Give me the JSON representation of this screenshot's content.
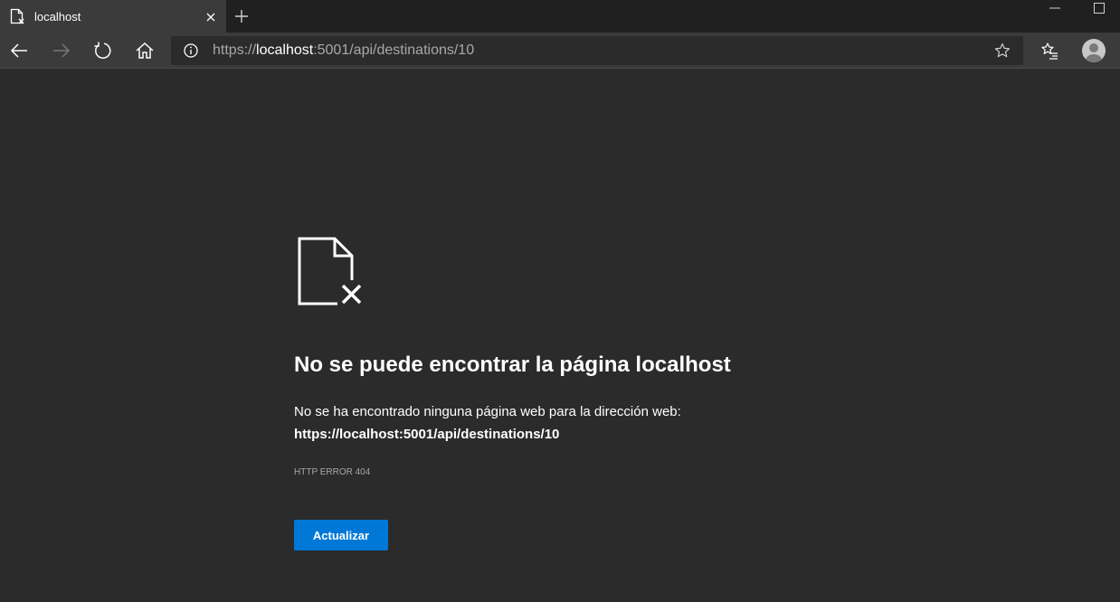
{
  "tab": {
    "title": "localhost",
    "favicon": "page-error-icon"
  },
  "address_bar": {
    "scheme": "https://",
    "host": "localhost",
    "rest": ":5001/api/destinations/10"
  },
  "icons": {
    "back": "back-arrow-icon",
    "forward": "forward-arrow-icon",
    "refresh": "refresh-icon",
    "home": "home-icon",
    "info": "info-icon",
    "favorite": "star-icon",
    "favorites_hub": "favorites-list-icon",
    "profile": "avatar",
    "new_tab": "plus-icon",
    "close_tab": "close-icon"
  },
  "error": {
    "title": "No se puede encontrar la página localhost",
    "description": "No se ha encontrado ninguna página web para la dirección web:",
    "url": "https://localhost:5001/api/destinations/10",
    "code": "HTTP ERROR 404",
    "button_label": "Actualizar"
  },
  "colors": {
    "background": "#2b2b2b",
    "toolbar": "#3b3b3b",
    "accent": "#0078d7"
  }
}
